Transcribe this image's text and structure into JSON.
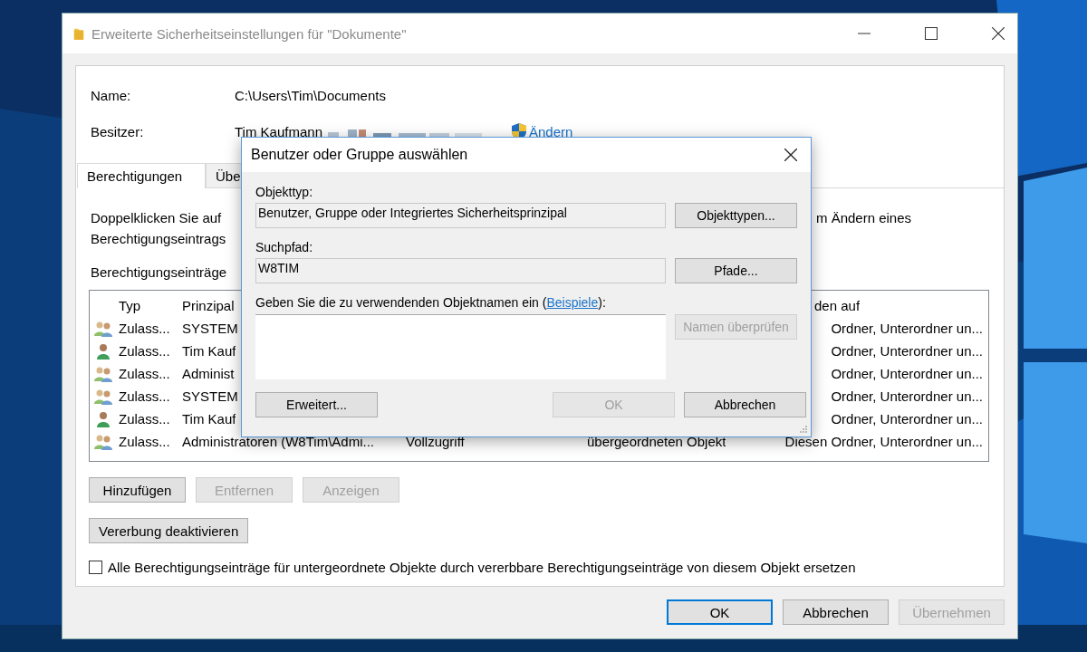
{
  "window": {
    "title": "Erweiterte Sicherheitseinstellungen für \"Dokumente\""
  },
  "name": {
    "label": "Name:",
    "value": "C:\\Users\\Tim\\Documents"
  },
  "owner": {
    "label": "Besitzer:",
    "value": "Tim Kaufmann",
    "change_link": "Ändern"
  },
  "tabs": [
    {
      "label": "Berechtigungen",
      "selected": true
    },
    {
      "label": "Übe",
      "selected": false
    }
  ],
  "description": {
    "line_1_start": "Doppelklicken Sie auf",
    "line_1_end": "m Ändern eines",
    "line_2_start": "Berechtigungseintrags"
  },
  "entries_label": "Berechtigungseinträge",
  "table": {
    "columns": [
      "Typ",
      "Prinzipal",
      "den auf"
    ],
    "rows": [
      {
        "kind": "group",
        "type": "Zulass...",
        "principal": "SYSTEM",
        "applies_to": "Ordner, Unterordner un..."
      },
      {
        "kind": "user",
        "type": "Zulass...",
        "principal": "Tim Kauf",
        "applies_to": "Ordner, Unterordner un..."
      },
      {
        "kind": "group",
        "type": "Zulass...",
        "principal": "Administ",
        "applies_to": "Ordner, Unterordner un..."
      },
      {
        "kind": "group",
        "type": "Zulass...",
        "principal": "SYSTEM",
        "applies_to": "Ordner, Unterordner un..."
      },
      {
        "kind": "user",
        "type": "Zulass...",
        "principal": "Tim Kauf",
        "applies_to": "Ordner, Unterordner un..."
      },
      {
        "kind": "group",
        "type": "Zulass...",
        "principal": "Administratoren (W8Tim\\Admi...",
        "access": "Vollzugriff",
        "inherited_from": "übergeordneten Objekt",
        "applies_to": "Diesen Ordner, Unterordner un..."
      }
    ]
  },
  "entry_buttons": [
    {
      "label": "Hinzufügen",
      "disabled": false
    },
    {
      "label": "Entfernen",
      "disabled": true
    },
    {
      "label": "Anzeigen",
      "disabled": true
    }
  ],
  "inheritance_button": "Vererbung deaktivieren",
  "replace_checkbox": {
    "label": "Alle Berechtigungseinträge für untergeordnete Objekte durch vererbbare Berechtigungseinträge von diesem Objekt ersetzen",
    "checked": false
  },
  "footer_buttons": [
    {
      "label": "OK",
      "disabled": false,
      "default": true
    },
    {
      "label": "Abbrechen",
      "disabled": false,
      "default": false
    },
    {
      "label": "Übernehmen",
      "disabled": true,
      "default": false
    }
  ],
  "dialog": {
    "title": "Benutzer oder Gruppe auswählen",
    "object_type": {
      "label": "Objekttyp:",
      "value": "Benutzer, Gruppe oder Integriertes Sicherheitsprinzipal",
      "button": "Objekttypen..."
    },
    "search_path": {
      "label": "Suchpfad:",
      "value": "W8TIM",
      "button": "Pfade..."
    },
    "names": {
      "label_start": "Geben Sie die zu verwendenden Objektnamen ein (",
      "link": "Beispiele",
      "label_end": "):",
      "check_button": {
        "label": "Namen überprüfen",
        "disabled": true
      }
    },
    "buttons": [
      {
        "label": "Erweitert...",
        "disabled": false
      },
      {
        "label": "OK",
        "disabled": true
      },
      {
        "label": "Abbrechen",
        "disabled": false
      }
    ]
  }
}
